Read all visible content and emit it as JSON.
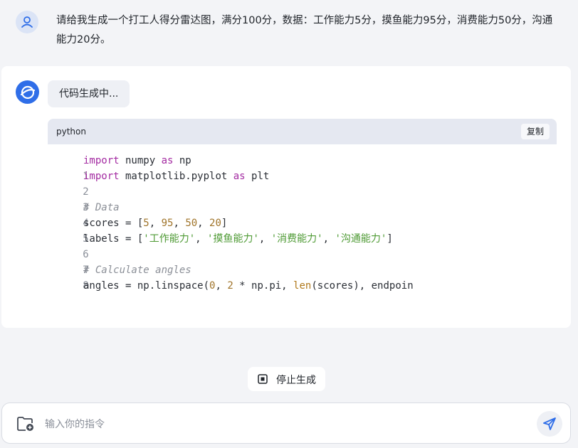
{
  "user_message": {
    "text": "请给我生成一个打工人得分雷达图，满分100分，数据：工作能力5分，摸鱼能力95分，消费能力50分，沟通能力20分。",
    "avatar_icon": "user-icon"
  },
  "assistant": {
    "avatar_icon": "assistant-logo-icon",
    "status": "代码生成中..."
  },
  "code_block": {
    "language": "python",
    "copy_label": "复制",
    "lines": [
      {
        "n": "1",
        "text": "import numpy as np"
      },
      {
        "n": "2",
        "text": "import matplotlib.pyplot as plt"
      },
      {
        "n": "3",
        "text": ""
      },
      {
        "n": "4",
        "text": "# Data"
      },
      {
        "n": "5",
        "text": "scores = [5, 95, 50, 20]"
      },
      {
        "n": "6",
        "text": "labels = ['工作能力', '摸鱼能力', '消费能力', '沟通能力']"
      },
      {
        "n": "7",
        "text": ""
      },
      {
        "n": "8",
        "text": "# Calculate angles"
      },
      {
        "n": "",
        "text": "angles = np.linspace(0, 2 * np.pi, len(scores), endpoin"
      }
    ]
  },
  "controls": {
    "stop_label": "停止生成",
    "stop_icon": "stop-icon"
  },
  "input": {
    "placeholder": "输入你的指令",
    "attach_icon": "folder-add-icon",
    "send_icon": "send-icon"
  },
  "colors": {
    "accent": "#2f6ee8",
    "background": "#f3f4f7"
  }
}
